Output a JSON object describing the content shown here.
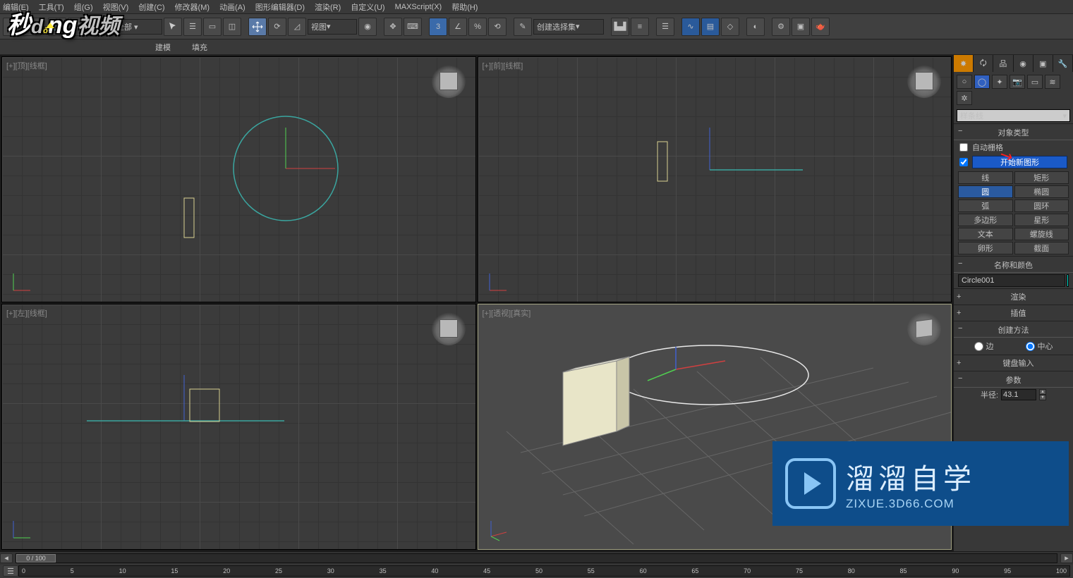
{
  "menu": [
    "编辑(E)",
    "工具(T)",
    "组(G)",
    "视图(V)",
    "创建(C)",
    "修改器(M)",
    "动画(A)",
    "图形编辑器(D)",
    "渲染(R)",
    "自定义(U)",
    "MAXScript(X)",
    "帮助(H)"
  ],
  "toolbar": {
    "view_set": "视图",
    "selection_set": "创建选择集"
  },
  "second_row": {
    "col1": "建模",
    "col2": "填充"
  },
  "viewports": {
    "tl": "[+][顶][线框]",
    "tr": "[+][前][线框]",
    "bl": "[+][左][线框]",
    "br": "[+][透视][真实]"
  },
  "panel": {
    "dropdown": "样条线",
    "section_objtype": "对象类型",
    "chk_autogrid": "自动栅格",
    "btn_newshape": "开始新图形",
    "shapes": [
      [
        "线",
        "矩形"
      ],
      [
        "圆",
        "椭圆"
      ],
      [
        "弧",
        "圆环"
      ],
      [
        "多边形",
        "星形"
      ],
      [
        "文本",
        "螺旋线"
      ],
      [
        "卵形",
        "截面"
      ]
    ],
    "active_shape": "圆",
    "section_namecolor": "名称和颜色",
    "obj_name": "Circle001",
    "rollout_render": "渲染",
    "rollout_interp": "插值",
    "section_create": "创建方法",
    "radio_edge": "边",
    "radio_center": "中心",
    "rollout_kb": "键盘输入",
    "section_params": "参数",
    "label_radius": "半径:",
    "radius_value": "43.1"
  },
  "timeline": {
    "thumb": "0 / 100",
    "ticks": [
      "0",
      "5",
      "10",
      "15",
      "20",
      "25",
      "30",
      "35",
      "40",
      "45",
      "50",
      "55",
      "60",
      "65",
      "70",
      "75",
      "80",
      "85",
      "90",
      "95",
      "100"
    ]
  },
  "watermark": {
    "cn": "溜溜自学",
    "en": "ZIXUE.3D66.COM"
  },
  "logo": "秒dòng视频"
}
